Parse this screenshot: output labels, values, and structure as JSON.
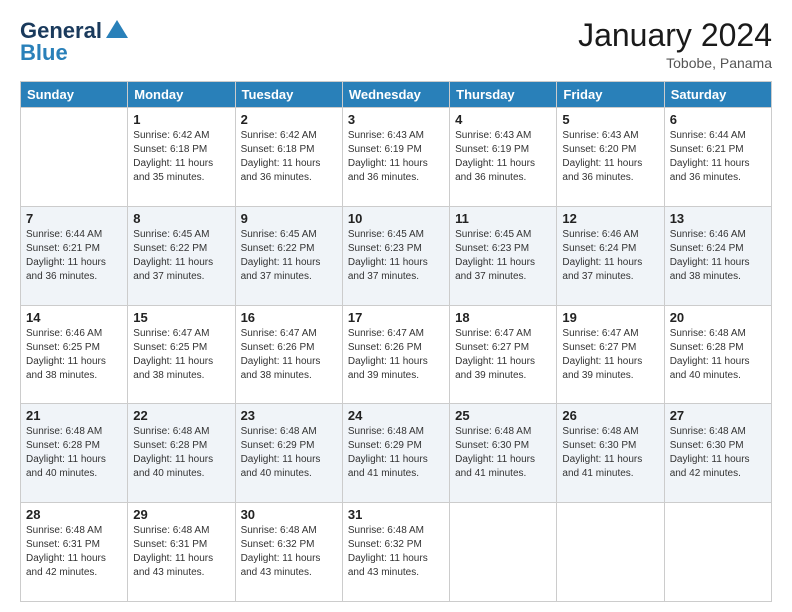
{
  "header": {
    "logo_line1": "General",
    "logo_line2": "Blue",
    "month_title": "January 2024",
    "location": "Tobobe, Panama"
  },
  "weekdays": [
    "Sunday",
    "Monday",
    "Tuesday",
    "Wednesday",
    "Thursday",
    "Friday",
    "Saturday"
  ],
  "weeks": [
    [
      {
        "day": "",
        "info": ""
      },
      {
        "day": "1",
        "info": "Sunrise: 6:42 AM\nSunset: 6:18 PM\nDaylight: 11 hours\nand 35 minutes."
      },
      {
        "day": "2",
        "info": "Sunrise: 6:42 AM\nSunset: 6:18 PM\nDaylight: 11 hours\nand 36 minutes."
      },
      {
        "day": "3",
        "info": "Sunrise: 6:43 AM\nSunset: 6:19 PM\nDaylight: 11 hours\nand 36 minutes."
      },
      {
        "day": "4",
        "info": "Sunrise: 6:43 AM\nSunset: 6:19 PM\nDaylight: 11 hours\nand 36 minutes."
      },
      {
        "day": "5",
        "info": "Sunrise: 6:43 AM\nSunset: 6:20 PM\nDaylight: 11 hours\nand 36 minutes."
      },
      {
        "day": "6",
        "info": "Sunrise: 6:44 AM\nSunset: 6:21 PM\nDaylight: 11 hours\nand 36 minutes."
      }
    ],
    [
      {
        "day": "7",
        "info": "Sunrise: 6:44 AM\nSunset: 6:21 PM\nDaylight: 11 hours\nand 36 minutes."
      },
      {
        "day": "8",
        "info": "Sunrise: 6:45 AM\nSunset: 6:22 PM\nDaylight: 11 hours\nand 37 minutes."
      },
      {
        "day": "9",
        "info": "Sunrise: 6:45 AM\nSunset: 6:22 PM\nDaylight: 11 hours\nand 37 minutes."
      },
      {
        "day": "10",
        "info": "Sunrise: 6:45 AM\nSunset: 6:23 PM\nDaylight: 11 hours\nand 37 minutes."
      },
      {
        "day": "11",
        "info": "Sunrise: 6:45 AM\nSunset: 6:23 PM\nDaylight: 11 hours\nand 37 minutes."
      },
      {
        "day": "12",
        "info": "Sunrise: 6:46 AM\nSunset: 6:24 PM\nDaylight: 11 hours\nand 37 minutes."
      },
      {
        "day": "13",
        "info": "Sunrise: 6:46 AM\nSunset: 6:24 PM\nDaylight: 11 hours\nand 38 minutes."
      }
    ],
    [
      {
        "day": "14",
        "info": "Sunrise: 6:46 AM\nSunset: 6:25 PM\nDaylight: 11 hours\nand 38 minutes."
      },
      {
        "day": "15",
        "info": "Sunrise: 6:47 AM\nSunset: 6:25 PM\nDaylight: 11 hours\nand 38 minutes."
      },
      {
        "day": "16",
        "info": "Sunrise: 6:47 AM\nSunset: 6:26 PM\nDaylight: 11 hours\nand 38 minutes."
      },
      {
        "day": "17",
        "info": "Sunrise: 6:47 AM\nSunset: 6:26 PM\nDaylight: 11 hours\nand 39 minutes."
      },
      {
        "day": "18",
        "info": "Sunrise: 6:47 AM\nSunset: 6:27 PM\nDaylight: 11 hours\nand 39 minutes."
      },
      {
        "day": "19",
        "info": "Sunrise: 6:47 AM\nSunset: 6:27 PM\nDaylight: 11 hours\nand 39 minutes."
      },
      {
        "day": "20",
        "info": "Sunrise: 6:48 AM\nSunset: 6:28 PM\nDaylight: 11 hours\nand 40 minutes."
      }
    ],
    [
      {
        "day": "21",
        "info": "Sunrise: 6:48 AM\nSunset: 6:28 PM\nDaylight: 11 hours\nand 40 minutes."
      },
      {
        "day": "22",
        "info": "Sunrise: 6:48 AM\nSunset: 6:28 PM\nDaylight: 11 hours\nand 40 minutes."
      },
      {
        "day": "23",
        "info": "Sunrise: 6:48 AM\nSunset: 6:29 PM\nDaylight: 11 hours\nand 40 minutes."
      },
      {
        "day": "24",
        "info": "Sunrise: 6:48 AM\nSunset: 6:29 PM\nDaylight: 11 hours\nand 41 minutes."
      },
      {
        "day": "25",
        "info": "Sunrise: 6:48 AM\nSunset: 6:30 PM\nDaylight: 11 hours\nand 41 minutes."
      },
      {
        "day": "26",
        "info": "Sunrise: 6:48 AM\nSunset: 6:30 PM\nDaylight: 11 hours\nand 41 minutes."
      },
      {
        "day": "27",
        "info": "Sunrise: 6:48 AM\nSunset: 6:30 PM\nDaylight: 11 hours\nand 42 minutes."
      }
    ],
    [
      {
        "day": "28",
        "info": "Sunrise: 6:48 AM\nSunset: 6:31 PM\nDaylight: 11 hours\nand 42 minutes."
      },
      {
        "day": "29",
        "info": "Sunrise: 6:48 AM\nSunset: 6:31 PM\nDaylight: 11 hours\nand 43 minutes."
      },
      {
        "day": "30",
        "info": "Sunrise: 6:48 AM\nSunset: 6:32 PM\nDaylight: 11 hours\nand 43 minutes."
      },
      {
        "day": "31",
        "info": "Sunrise: 6:48 AM\nSunset: 6:32 PM\nDaylight: 11 hours\nand 43 minutes."
      },
      {
        "day": "",
        "info": ""
      },
      {
        "day": "",
        "info": ""
      },
      {
        "day": "",
        "info": ""
      }
    ]
  ]
}
